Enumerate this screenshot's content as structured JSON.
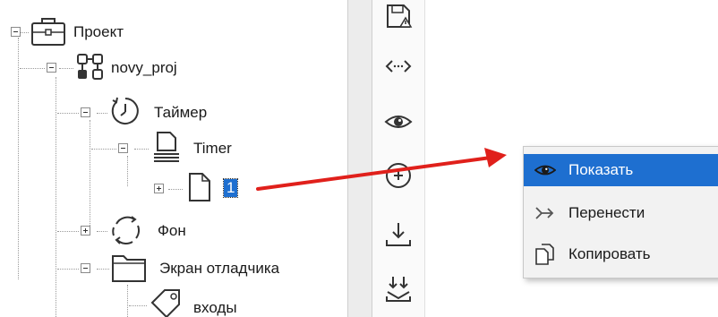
{
  "tree": {
    "root": {
      "label": "Проект",
      "icon": "briefcase-icon"
    },
    "project": {
      "label": "novy_proj",
      "icon": "network-icon"
    },
    "timer_group": {
      "label": "Таймер",
      "icon": "clock-icon"
    },
    "timer_item": {
      "label": "Timer",
      "icon": "document-stack-icon"
    },
    "timer_child": {
      "label": "1",
      "icon": "page-icon"
    },
    "background": {
      "label": "Фон",
      "icon": "cycle-arrows-icon"
    },
    "debug_screen": {
      "label": "Экран отладчика",
      "icon": "folder-icon"
    },
    "inputs": {
      "label": "входы",
      "icon": "tag-icon"
    }
  },
  "toolbar_icons": [
    "save-warning-icon",
    "code-brackets-icon",
    "eye-icon",
    "add-circle-icon",
    "download-icon",
    "merge-down-icon"
  ],
  "context_menu": {
    "items": [
      {
        "label": "Показать",
        "icon": "eye-icon",
        "active": true
      },
      {
        "label": "Перенести",
        "icon": "move-arrow-icon",
        "active": false
      },
      {
        "label": "Копировать",
        "icon": "copy-icon",
        "active": false
      }
    ]
  },
  "colors": {
    "selection": "#1e6fd0",
    "annotation_arrow": "#e0201b",
    "menu_background": "#f2f2f2"
  }
}
